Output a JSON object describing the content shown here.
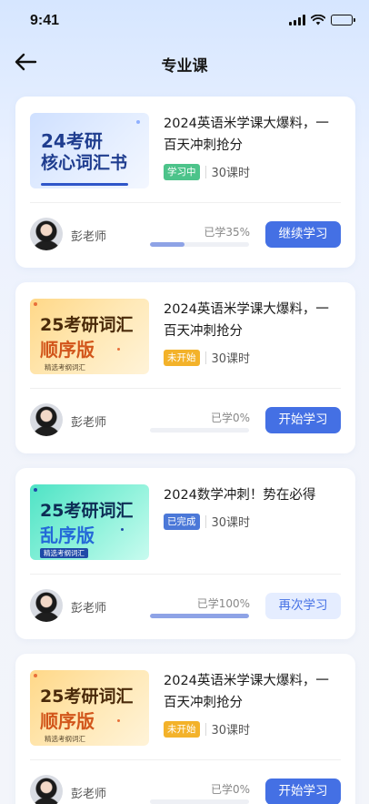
{
  "status_bar": {
    "time": "9:41"
  },
  "header": {
    "title": "专业课"
  },
  "courses": [
    {
      "thumb_line1": "24考研",
      "thumb_line2": "核心词汇书",
      "thumb_sub": "",
      "title": "2024英语米学课大爆料，一百天冲刺抢分",
      "tag": "学习中",
      "tag_color": "#4cc38a",
      "hours": "30课时",
      "teacher": "彭老师",
      "progress_text": "已学35%",
      "progress": 35,
      "button": "继续学习"
    },
    {
      "thumb_line1": "25考研词汇",
      "thumb_line2": "顺序版",
      "thumb_sub": "精选考纲词汇",
      "title": "2024英语米学课大爆料，一百天冲刺抢分",
      "tag": "未开始",
      "tag_color": "#f3b22a",
      "hours": "30课时",
      "teacher": "彭老师",
      "progress_text": "已学0%",
      "progress": 0,
      "button": "开始学习"
    },
    {
      "thumb_line1": "25考研词汇",
      "thumb_line2": "乱序版",
      "thumb_sub": "精选考纲词汇",
      "title": "2024数学冲刺！势在必得",
      "tag": "已完成",
      "tag_color": "#4b78d8",
      "hours": "30课时",
      "teacher": "彭老师",
      "progress_text": "已学100%",
      "progress": 100,
      "button": "再次学习"
    },
    {
      "thumb_line1": "25考研词汇",
      "thumb_line2": "顺序版",
      "thumb_sub": "精选考纲词汇",
      "title": "2024英语米学课大爆料，一百天冲刺抢分",
      "tag": "未开始",
      "tag_color": "#f3b22a",
      "hours": "30课时",
      "teacher": "彭老师",
      "progress_text": "已学0%",
      "progress": 0,
      "button": "开始学习"
    }
  ],
  "icons": {
    "back": "arrow-left-icon",
    "signal": "cellular-signal-icon",
    "wifi": "wifi-icon",
    "battery": "battery-icon"
  },
  "colors": {
    "accent": "#4470e4"
  }
}
